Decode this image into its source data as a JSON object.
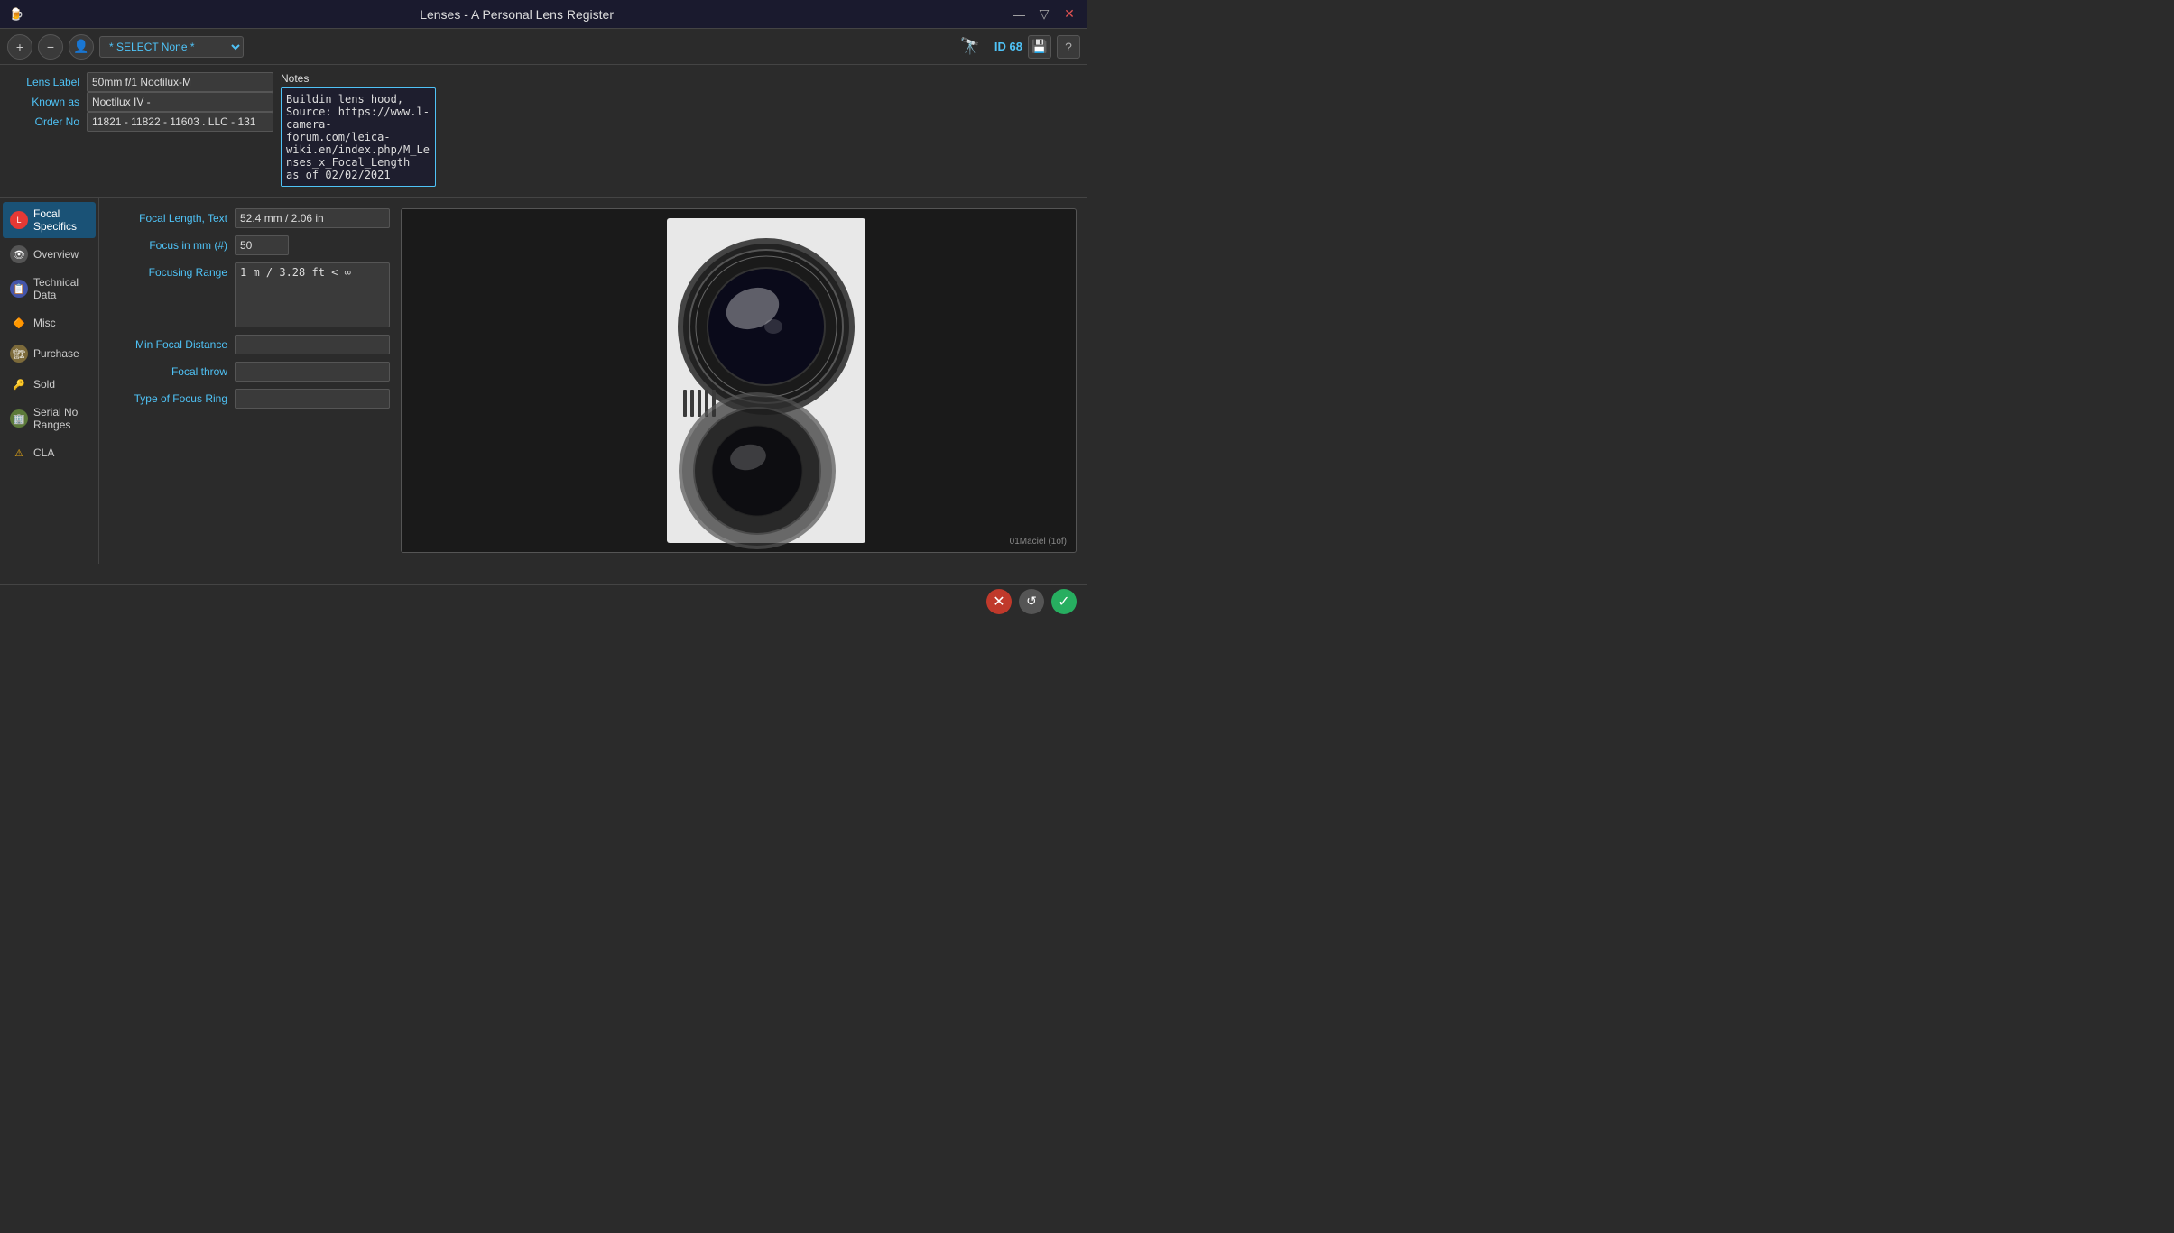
{
  "titleBar": {
    "appIcon": "🍺",
    "title": "Lenses - A Personal Lens Register",
    "minimizeLabel": "—",
    "maximizeLabel": "▽",
    "closeLabel": "✕"
  },
  "toolbar": {
    "addLabel": "+",
    "removeLabel": "−",
    "userLabel": "👤",
    "selectPlaceholder": "* SELECT None *",
    "searchLabel": "🔭",
    "idLabel": "ID",
    "idValue": "68",
    "saveLabel": "💾",
    "helpLabel": "?"
  },
  "header": {
    "lensLabelLabel": "Lens Label",
    "lensLabelValue": "50mm f/1 Noctilux-M",
    "knownAsLabel": "Known as",
    "knownAsValue": "Noctilux IV -",
    "orderNoLabel": "Order No",
    "orderNoValue": "11821 - 11822 - 11603 . LLC - 131",
    "notesLabel": "Notes",
    "notesValue": "Buildin lens hood, Source: https://www.l-camera-forum.com/leica-wiki.en/index.php/M_Lenses_x_Focal_Length  as of 02/02/2021"
  },
  "sidebar": {
    "items": [
      {
        "id": "focal-specifics",
        "label": "Focal Specifics",
        "icon": "L",
        "iconType": "focal",
        "active": true
      },
      {
        "id": "overview",
        "label": "Overview",
        "icon": "👁",
        "iconType": "overview",
        "active": false
      },
      {
        "id": "technical-data",
        "label": "Technical Data",
        "icon": "📋",
        "iconType": "techdata",
        "active": false
      },
      {
        "id": "misc",
        "label": "Misc",
        "icon": "🔶",
        "iconType": "misc",
        "active": false
      },
      {
        "id": "purchase",
        "label": "Purchase",
        "icon": "🏗",
        "iconType": "purchase",
        "active": false
      },
      {
        "id": "sold",
        "label": "Sold",
        "icon": "🔑",
        "iconType": "sold",
        "active": false
      },
      {
        "id": "serial-no-ranges",
        "label": "Serial No Ranges",
        "icon": "🏢",
        "iconType": "serial",
        "active": false
      },
      {
        "id": "cla",
        "label": "CLA",
        "icon": "⚠",
        "iconType": "cla",
        "active": false
      }
    ]
  },
  "focalSpecifics": {
    "focalLengthTextLabel": "Focal Length, Text",
    "focalLengthTextValue": "52.4 mm / 2.06 in",
    "focusInMmLabel": "Focus in mm (#)",
    "focusInMmValue": "50",
    "focusingRangeLabel": "Focusing Range",
    "focusingRangeValue": "1 m / 3.28 ft < ∞",
    "minFocalDistanceLabel": "Min Focal Distance",
    "minFocalDistanceValue": "",
    "focalThrowLabel": "Focal throw",
    "focalThrowValue": "",
    "typeOfFocusRingLabel": "Type of Focus Ring",
    "typeOfFocusRingValue": ""
  },
  "image": {
    "caption": "01Maciel (1of)"
  },
  "bottomBar": {
    "cancelLabel": "✕",
    "neutralLabel": "↺",
    "okLabel": "✓"
  }
}
